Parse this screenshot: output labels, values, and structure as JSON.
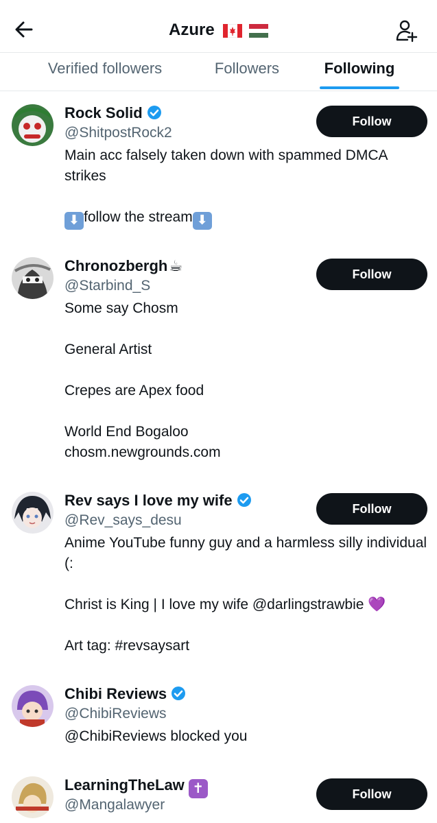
{
  "header": {
    "title": "Azure",
    "flag_1": "Canada flag",
    "flag_2": "Hungary flag"
  },
  "tabs": [
    {
      "label": "Verified followers"
    },
    {
      "label": "Followers"
    },
    {
      "label": "Following",
      "active": true
    }
  ],
  "colors": {
    "accent": "#1d9bf0",
    "verified": "#1d9bf0",
    "button_bg": "#0f1419",
    "secondary_text": "#536471"
  },
  "users": [
    {
      "name": "Rock Solid",
      "verified": true,
      "handle": "@ShitpostRock2",
      "bio_line1": "Main acc falsely taken down with spammed DMCA strikes",
      "bio_line2": "follow the stream",
      "follow_label": "Follow"
    },
    {
      "name": "Chronozbergh",
      "name_emoji": "☕",
      "handle": "@Starbind_S",
      "bio": "Some say Chosm\n\nGeneral Artist\n\nCrepes are Apex food\n\nWorld End Bogaloo\nchosm.newgrounds.com",
      "follow_label": "Follow"
    },
    {
      "name": "Rev says I love my wife",
      "verified": true,
      "handle": "@Rev_says_desu",
      "bio": "Anime YouTube funny guy and a harmless silly individual (:\n\nChrist is King | I love my wife @darlingstrawbie 💜\n\nArt tag: #revsaysart",
      "follow_label": "Follow"
    },
    {
      "name": "Chibi Reviews",
      "verified": true,
      "handle": "@ChibiReviews",
      "bio": "@ChibiReviews blocked you"
    },
    {
      "name": "LearningTheLaw",
      "name_emoji": "✝",
      "handle": "@Mangalawyer",
      "follow_label": "Follow"
    }
  ]
}
